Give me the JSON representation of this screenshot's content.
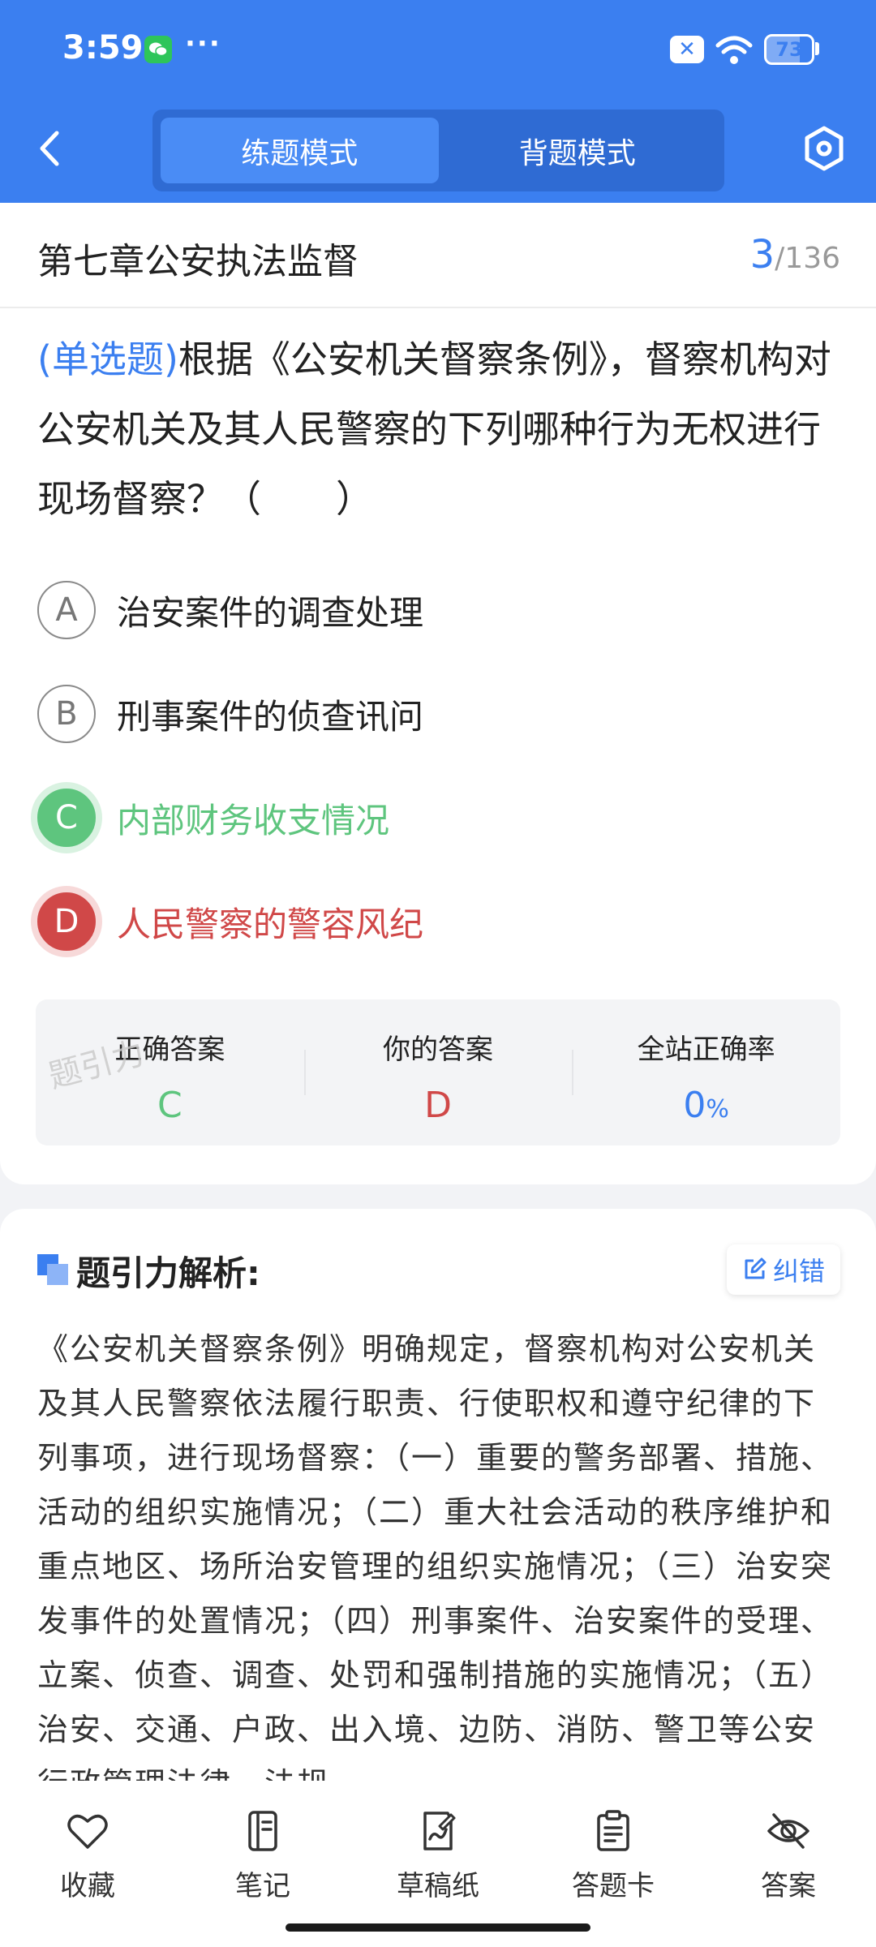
{
  "status_bar": {
    "time": "3:59",
    "more": "···",
    "battery": "73"
  },
  "header": {
    "modes": [
      {
        "label": "练题模式",
        "active": true
      },
      {
        "label": "背题模式",
        "active": false
      }
    ]
  },
  "chapter": {
    "title": "第七章公安执法监督",
    "current": "3",
    "total": "/136"
  },
  "question": {
    "type": "(单选题)",
    "text": "根据《公安机关督察条例》，督察机构对公安机关及其人民警察的下列哪种行为无权进行现场督察？（　　）",
    "options": [
      {
        "letter": "A",
        "text": "治安案件的调查处理",
        "state": "normal"
      },
      {
        "letter": "B",
        "text": "刑事案件的侦查讯问",
        "state": "normal"
      },
      {
        "letter": "C",
        "text": "内部财务收支情况",
        "state": "correct"
      },
      {
        "letter": "D",
        "text": "人民警察的警容风纪",
        "state": "wrong"
      }
    ]
  },
  "answer_summary": {
    "correct_label": "正确答案",
    "correct_value": "C",
    "yours_label": "你的答案",
    "yours_value": "D",
    "rate_label": "全站正确率",
    "rate_value": "0",
    "rate_unit": "%",
    "watermark": "题引力"
  },
  "analysis": {
    "title": "题引力解析:",
    "report_label": "纠错",
    "text": "《公安机关督察条例》明确规定，督察机构对公安机关及其人民警察依法履行职责、行使职权和遵守纪律的下列事项，进行现场督察：（一）重要的警务部署、措施、活动的组织实施情况；（二）重大社会活动的秩序维护和重点地区、场所治安管理的组织实施情况；（三）治安突发事件的处置情况；（四）刑事案件、治安案件的受理、立案、侦查、调查、处罚和强制措施的实施情况；（五）治安、交通、户政、出入境、边防、消防、警卫等公安行政管理法律、法规"
  },
  "bottom_nav": [
    {
      "label": "收藏",
      "icon": "heart-icon"
    },
    {
      "label": "笔记",
      "icon": "notebook-icon"
    },
    {
      "label": "草稿纸",
      "icon": "draft-icon"
    },
    {
      "label": "答题卡",
      "icon": "clipboard-icon"
    },
    {
      "label": "答案",
      "icon": "eye-off-icon"
    }
  ],
  "colors": {
    "brand": "#3b7ff0",
    "correct": "#5ec57e",
    "wrong": "#d04848"
  }
}
